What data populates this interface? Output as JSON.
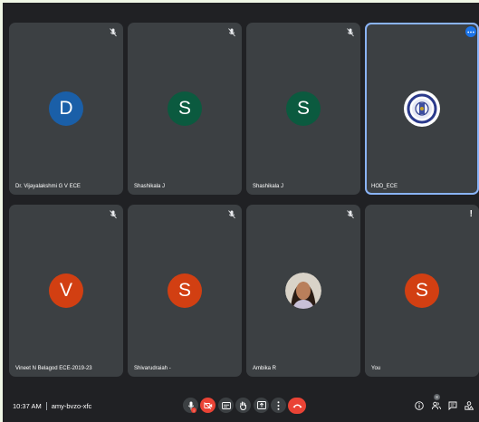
{
  "participants": [
    {
      "name": "Dr. Vijayalakshmi G V ECE",
      "initial": "D",
      "color": "#1a5fa8",
      "muted": true
    },
    {
      "name": "Shashikala J",
      "initial": "S",
      "color": "#0b5a3f",
      "muted": true
    },
    {
      "name": "Shashikala J",
      "initial": "S",
      "color": "#0b5a3f",
      "muted": true
    },
    {
      "name": "HOD_ECE",
      "avatar": "college-emblem",
      "active_speaker": true,
      "more_options": true
    },
    {
      "name": "Vineet N Belagod ECE-2019-23",
      "initial": "V",
      "color": "#d23f12",
      "muted": true
    },
    {
      "name": "Shivarudraiah -",
      "initial": "S",
      "color": "#d23f12",
      "muted": true
    },
    {
      "name": "Ambika R",
      "avatar": "profile-photo",
      "muted": true
    },
    {
      "name": "You",
      "initial": "S",
      "color": "#d23f12",
      "alert": true
    }
  ],
  "bottom_bar": {
    "time": "10:37 AM",
    "meeting_code": "amy-bvzo-xfc",
    "mic_badge": "!",
    "participant_count": "8"
  },
  "colors": {
    "background": "#202124",
    "tile": "#3c4043",
    "danger": "#ea4335",
    "accent": "#8ab4f8"
  }
}
